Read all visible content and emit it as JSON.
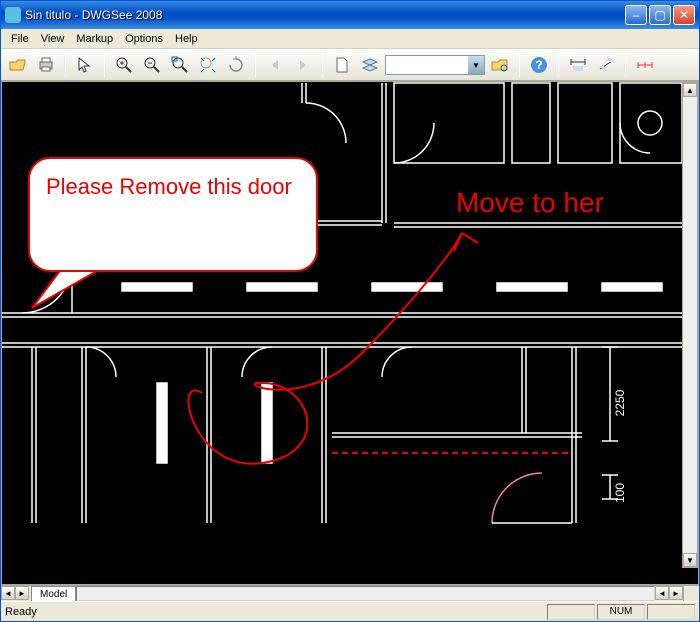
{
  "window": {
    "title": "Sin titulo - DWGSee 2008"
  },
  "menu": {
    "file": "File",
    "view": "View",
    "markup": "Markup",
    "options": "Options",
    "help": "Help"
  },
  "toolbar": {
    "open": "open",
    "print": "print",
    "select": "select",
    "zoom_in": "zoom-in",
    "zoom_out": "zoom-out",
    "zoom_window": "zoom-window",
    "zoom_extents": "zoom-extents",
    "rotate": "rotate",
    "back": "back",
    "forward": "forward",
    "doc": "document",
    "layers": "layers",
    "combo_value": "",
    "combo_placeholder": "",
    "browse": "browse",
    "help": "?",
    "dim1": "dim-linear",
    "dim2": "dim-aligned",
    "dim3": "dim-continue"
  },
  "canvas": {
    "speech_text": "Please Remove this door",
    "markup_text": "Move to her",
    "dims": {
      "a": "2250",
      "b": "100"
    }
  },
  "tabs": {
    "model": "Model"
  },
  "status": {
    "ready": "Ready",
    "num": "NUM"
  },
  "colors": {
    "markup_red": "#ee0000",
    "bg_black": "#000000",
    "drawing_white": "#ffffff"
  }
}
